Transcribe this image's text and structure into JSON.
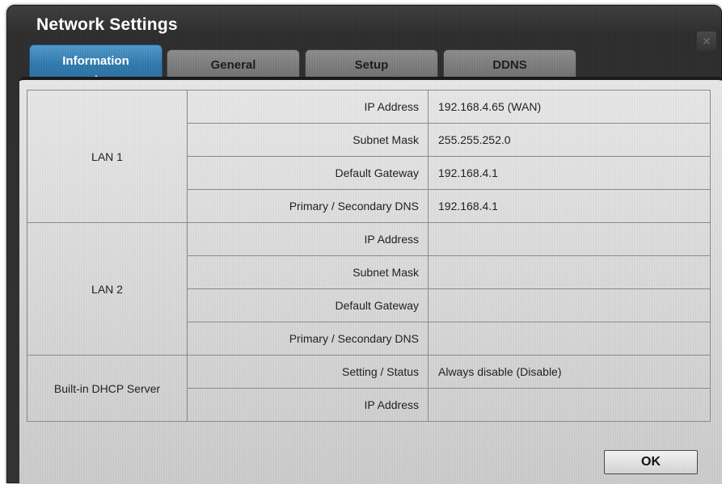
{
  "window": {
    "title": "Network Settings",
    "close_glyph": "✕"
  },
  "tabs": [
    {
      "label": "Information",
      "active": true
    },
    {
      "label": "General",
      "active": false
    },
    {
      "label": "Setup",
      "active": false
    },
    {
      "label": "DDNS",
      "active": false
    }
  ],
  "info": {
    "lan1": {
      "group_label": "LAN 1",
      "rows": [
        {
          "label": "IP Address",
          "value": "192.168.4.65 (WAN)"
        },
        {
          "label": "Subnet Mask",
          "value": "255.255.252.0"
        },
        {
          "label": "Default Gateway",
          "value": "192.168.4.1"
        },
        {
          "label": "Primary / Secondary DNS",
          "value": "192.168.4.1"
        }
      ]
    },
    "lan2": {
      "group_label": "LAN 2",
      "rows": [
        {
          "label": "IP Address",
          "value": ""
        },
        {
          "label": "Subnet Mask",
          "value": ""
        },
        {
          "label": "Default Gateway",
          "value": ""
        },
        {
          "label": "Primary / Secondary DNS",
          "value": ""
        }
      ]
    },
    "dhcp": {
      "group_label": "Built-in DHCP Server",
      "rows": [
        {
          "label": "Setting / Status",
          "value": "Always disable (Disable)"
        },
        {
          "label": "IP Address",
          "value": ""
        }
      ]
    }
  },
  "buttons": {
    "ok_label": "OK"
  },
  "colors": {
    "active_tab": "#2d78ad",
    "window_bg": "#2f2f2f",
    "panel_bg": "#d8d8d8"
  }
}
